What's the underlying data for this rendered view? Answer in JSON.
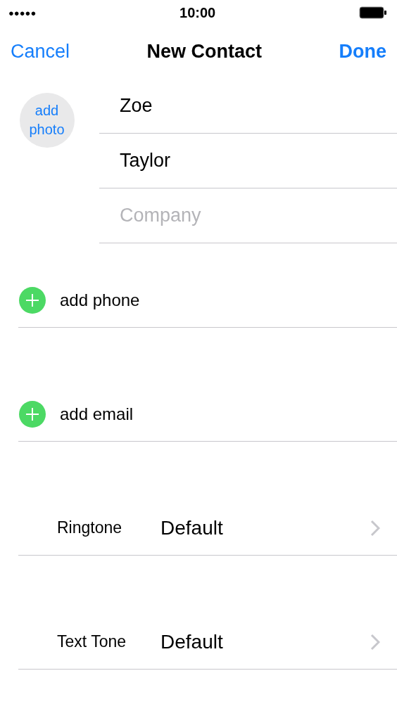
{
  "status_bar": {
    "signal_dots": "●●●●●",
    "time": "10:00"
  },
  "nav": {
    "cancel": "Cancel",
    "title": "New Contact",
    "done": "Done"
  },
  "photo": {
    "label": "add photo"
  },
  "name_fields": [
    {
      "value": "Zoe"
    },
    {
      "value": "Taylor"
    },
    {
      "placeholder": "Company"
    }
  ],
  "sections": [
    {
      "kind": "add",
      "label": "add phone"
    },
    {
      "kind": "add",
      "label": "add email"
    },
    {
      "kind": "setting",
      "label": "Ringtone",
      "value": "Default"
    },
    {
      "kind": "setting",
      "label": "Text Tone",
      "value": "Default"
    }
  ]
}
